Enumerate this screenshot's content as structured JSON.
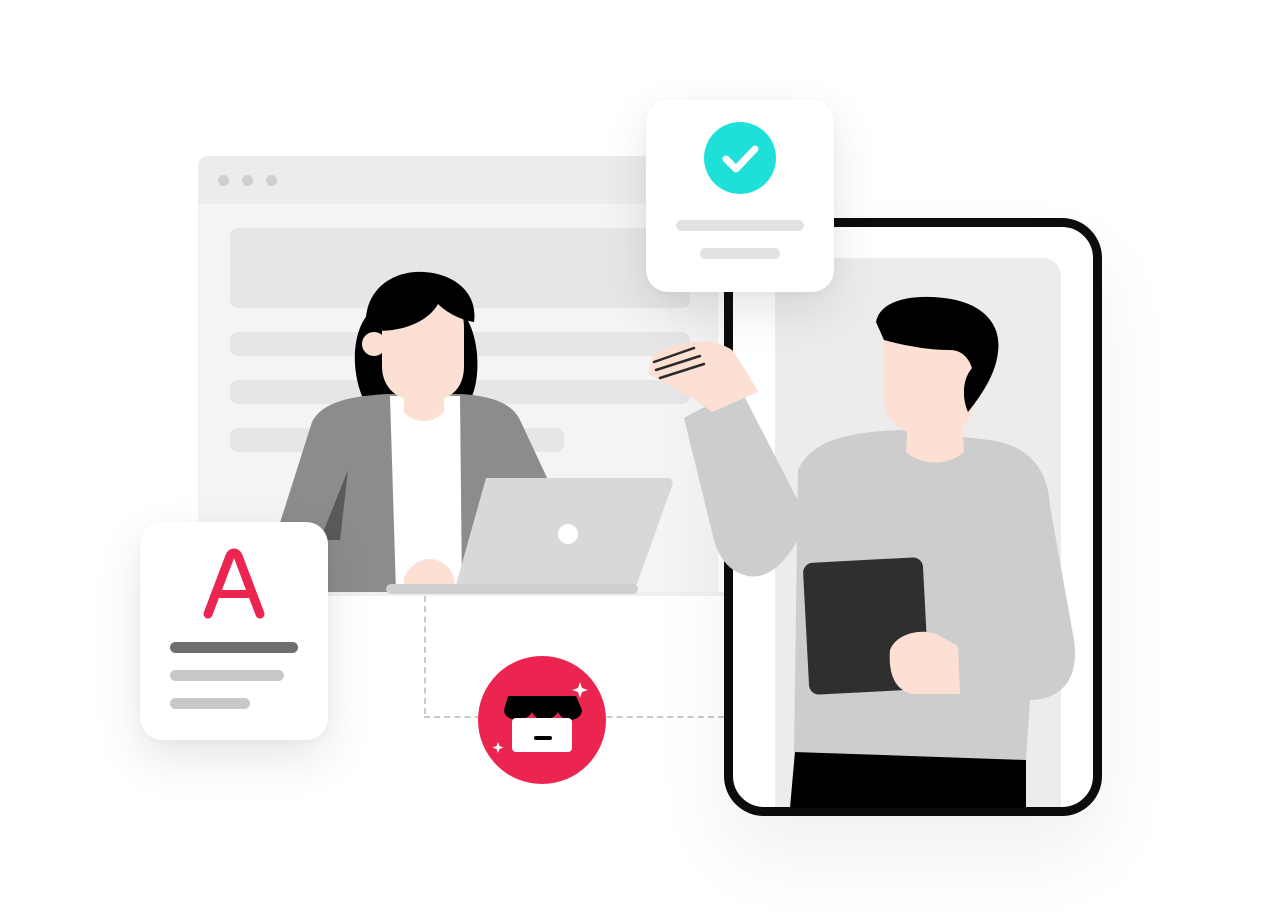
{
  "illustration": {
    "background": "#ffffff",
    "accent_red": "#ec2450",
    "accent_teal": "#1ee0d9",
    "browser_window": {
      "controls": [
        "dot",
        "dot",
        "dot"
      ]
    },
    "status_card": {
      "icon": "check-circle-icon",
      "icon_color": "#1ee0d9"
    },
    "brand_card": {
      "logo_letter": "A",
      "logo_color": "#ec2450"
    },
    "store_badge": {
      "icon": "storefront-icon",
      "color": "#ec2450"
    },
    "people": [
      "woman-with-laptop",
      "man-with-tablet"
    ]
  }
}
